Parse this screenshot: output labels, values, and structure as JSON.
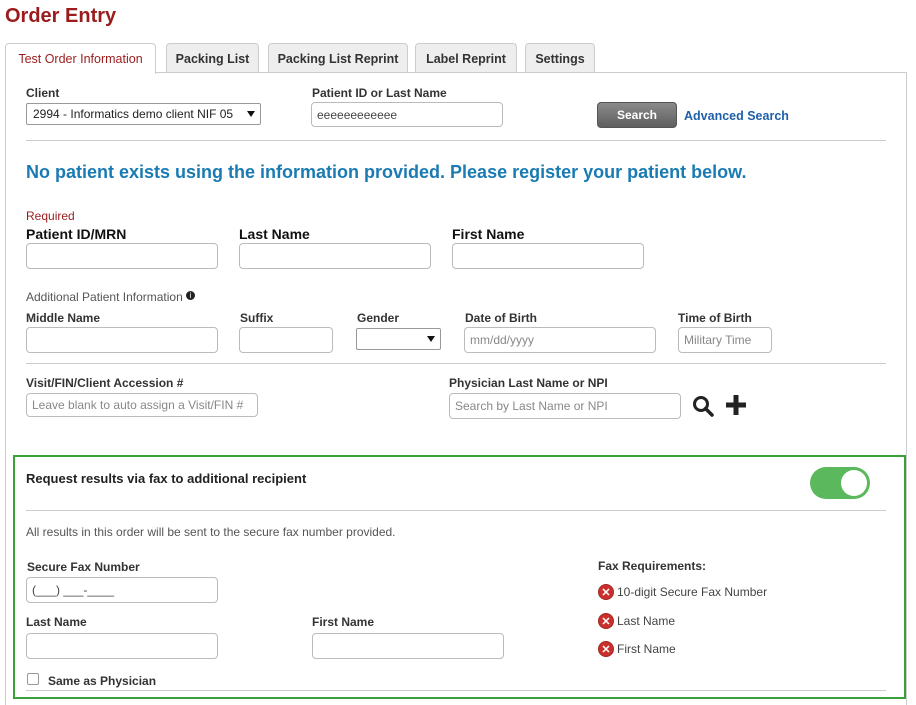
{
  "page_title": "Order Entry",
  "tabs": [
    {
      "label": "Test Order Information",
      "active": true
    },
    {
      "label": "Packing List",
      "active": false
    },
    {
      "label": "Packing List Reprint",
      "active": false
    },
    {
      "label": "Label Reprint",
      "active": false
    },
    {
      "label": "Settings",
      "active": false
    }
  ],
  "search": {
    "client_label": "Client",
    "client_value": "2994 - Informatics demo client NIF 05",
    "patient_label": "Patient ID or Last Name",
    "patient_value": "eeeeeeeeeeee",
    "search_button": "Search",
    "advanced_link": "Advanced Search"
  },
  "notice": "No patient exists using the information provided. Please register your patient below.",
  "required_section": {
    "required_label": "Required",
    "patient_id_label": "Patient ID/MRN",
    "last_name_label": "Last Name",
    "first_name_label": "First Name"
  },
  "additional": {
    "section_label": "Additional Patient Information",
    "info_icon": "info-icon",
    "middle_name_label": "Middle Name",
    "suffix_label": "Suffix",
    "gender_label": "Gender",
    "dob_label": "Date of Birth",
    "dob_placeholder": "mm/dd/yyyy",
    "tob_label": "Time of Birth",
    "tob_placeholder": "Military Time"
  },
  "visit": {
    "visit_label": "Visit/FIN/Client Accession #",
    "visit_placeholder": "Leave blank to auto assign a Visit/FIN #",
    "physician_label": "Physician Last Name or NPI",
    "physician_placeholder": "Search by Last Name or NPI",
    "search_icon": "search-icon",
    "add_icon": "plus-icon"
  },
  "fax": {
    "title": "Request results via fax to additional recipient",
    "toggle_on": true,
    "description": "All results in this order will be sent to the secure fax number provided.",
    "fax_number_label": "Secure Fax Number",
    "fax_number_value": "(___) ___-____",
    "last_name_label": "Last Name",
    "first_name_label": "First Name",
    "same_as_physician": "Same as Physician",
    "requirements_title": "Fax Requirements:",
    "requirements": [
      "10-digit Secure Fax Number",
      "Last Name",
      "First Name"
    ]
  },
  "colors": {
    "title": "#9b1c1c",
    "notice": "#1a7bb3",
    "link": "#1f5fa8",
    "toggle": "#5cb85c",
    "fax_border": "#3aa13a",
    "error_icon": "#c9302c"
  }
}
